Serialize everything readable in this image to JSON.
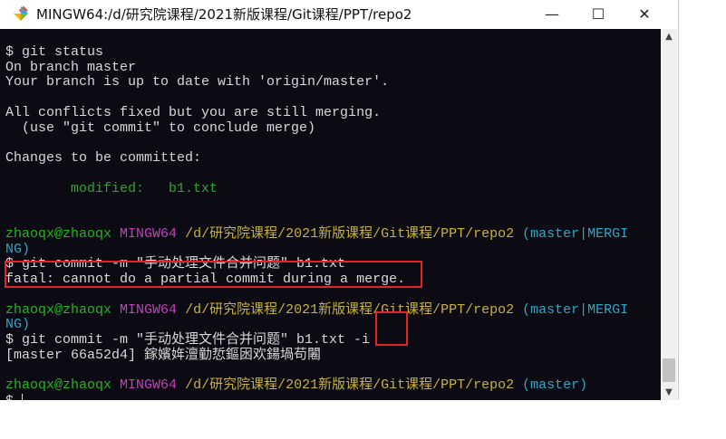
{
  "window": {
    "title": "MINGW64:/d/研究院课程/2021新版课程/Git课程/PPT/repo2",
    "controls": {
      "minimize": "—",
      "maximize": "☐",
      "close": "✕"
    }
  },
  "colors": {
    "user": "#23b521",
    "host": "#c43fbe",
    "path": "#c7b23a",
    "branch": "#2aa8c8",
    "highlight_box": "#e8202a"
  },
  "terminal": {
    "status_cmd": "$ git status",
    "l1": "On branch master",
    "l2": "Your branch is up to date with 'origin/master'.",
    "l3": "All conflicts fixed but you are still merging.",
    "l4": "  (use \"git commit\" to conclude merge)",
    "l5": "Changes to be committed:",
    "modified": "        modified:   b1.txt",
    "prompt_user": "zhaoqx@zhaoqx",
    "prompt_host": "MINGW64",
    "prompt_path": "/d/研究院课程/2021新版课程/Git课程/PPT/repo2",
    "branch_merging_1": "(master|MERGI",
    "branch_merging_2": "NG)",
    "branch_master": "(master)",
    "cmd1": "$ git commit -m \"手动处理文件合并问题\" b1.txt",
    "error": "fatal: cannot do a partial commit during a merge.",
    "cmd2": "$ git commit -m \"手动处理文件合并问题\" b1.txt ",
    "cmd2_flag": "-i",
    "result": "[master 66a52d4] 鎵嬪姩澶勭悊鏂囦欢鍚堝苟闂",
    "final_prompt": "$ "
  }
}
